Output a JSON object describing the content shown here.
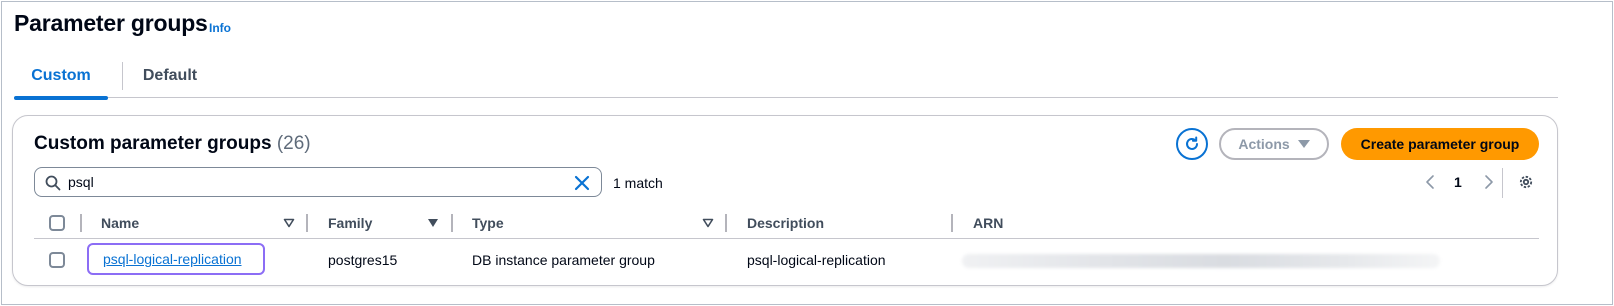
{
  "header": {
    "title": "Parameter groups",
    "info_label": "Info"
  },
  "tabs": [
    {
      "label": "Custom",
      "active": true
    },
    {
      "label": "Default",
      "active": false
    }
  ],
  "panel": {
    "title": "Custom parameter groups",
    "count": "(26)",
    "refresh_icon": "refresh-icon",
    "actions_label": "Actions",
    "create_label": "Create parameter group"
  },
  "filter": {
    "value": "psql",
    "match_text": "1 match"
  },
  "pagination": {
    "current_page": "1"
  },
  "table": {
    "columns": [
      "Name",
      "Family",
      "Type",
      "Description",
      "ARN"
    ],
    "rows": [
      {
        "name": "psql-logical-replication",
        "family": "postgres15",
        "type": "DB instance parameter group",
        "description": "psql-logical-replication",
        "arn": ""
      }
    ]
  },
  "colors": {
    "accent": "#0972d3",
    "primary_button": "#ff9900",
    "focus_ring": "#8c6df5",
    "text": "#000716",
    "muted": "#5f6b7a"
  }
}
